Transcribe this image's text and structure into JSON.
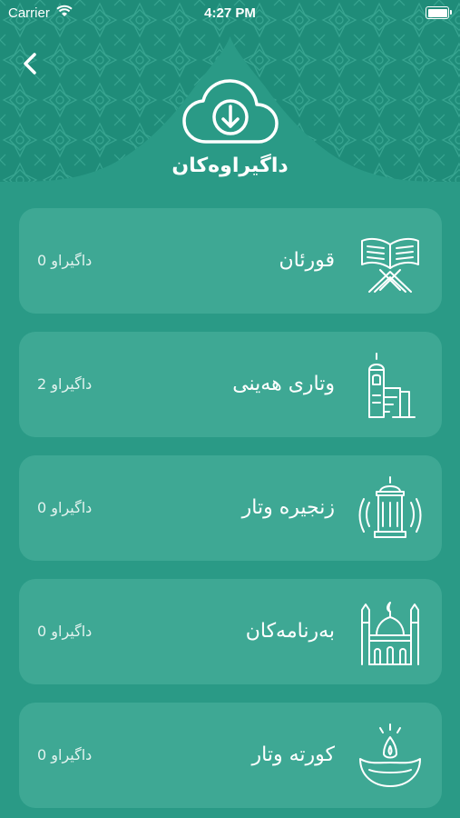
{
  "status_bar": {
    "carrier": "Carrier",
    "time": "4:27 PM"
  },
  "header": {
    "title": "داگیراوەکان"
  },
  "categories": [
    {
      "title": "قورئان",
      "count": "0 داگیراو",
      "icon": "quran-book-icon"
    },
    {
      "title": "وتاری هەینی",
      "count": "2 داگیراو",
      "icon": "minaret-pulpit-icon"
    },
    {
      "title": "زنجیرە وتار",
      "count": "0 داگیراو",
      "icon": "lantern-audio-icon"
    },
    {
      "title": "بەرنامەکان",
      "count": "0 داگیراو",
      "icon": "mosque-icon"
    },
    {
      "title": "کورتە وتار",
      "count": "0 داگیراو",
      "icon": "oil-lamp-icon"
    }
  ],
  "colors": {
    "background": "#2a9a86",
    "header": "#1f8c79",
    "card": "#3ea894"
  }
}
